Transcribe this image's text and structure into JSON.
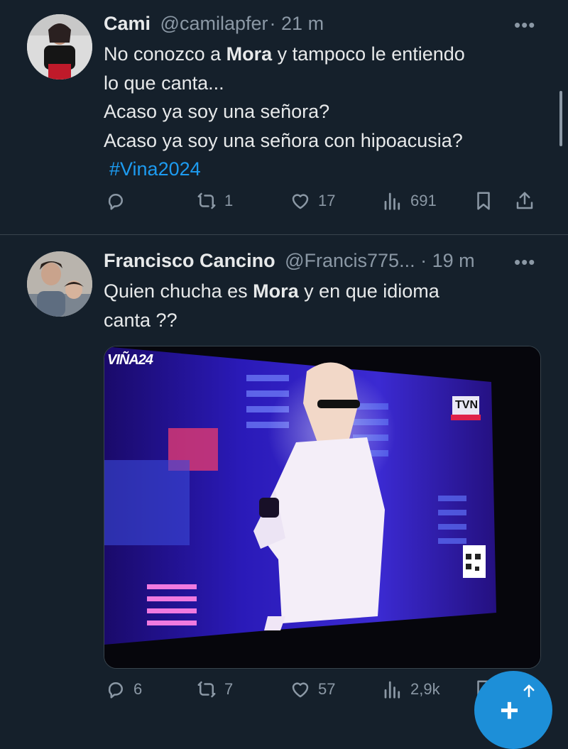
{
  "tweets": [
    {
      "author_name": "Cami",
      "handle": "@camilapfer",
      "separator": "·",
      "time": "21 m",
      "more": "•••",
      "lines": [
        {
          "pre": "No conozco a ",
          "bold": "Mora",
          "post": " y tampoco le entiendo"
        },
        {
          "text": "lo que canta..."
        },
        {
          "text": "Acaso ya soy una señora?"
        },
        {
          "text": "Acaso ya soy una señora con hipoacusia?"
        }
      ],
      "hashtag": "#Vina2024",
      "actions": {
        "reply": "",
        "retweet": "1",
        "like": "17",
        "views": "691"
      },
      "icons": [
        "reply-icon",
        "retweet-icon",
        "like-icon",
        "views-icon",
        "bookmark-icon",
        "share-icon"
      ]
    },
    {
      "author_name": "Francisco Cancino",
      "handle": "@Francis775...",
      "separator": "·",
      "time": "19 m",
      "more": "•••",
      "lines": [
        {
          "pre": "Quien chucha es ",
          "bold": "Mora",
          "post": " y en que idioma"
        },
        {
          "text": "canta ??"
        }
      ],
      "media": {
        "overlay_left": "VIÑA24",
        "overlay_right": "TVN"
      },
      "actions": {
        "reply": "6",
        "retweet": "7",
        "like": "57",
        "views": "2,9k"
      },
      "icons": [
        "reply-icon",
        "retweet-icon",
        "like-icon",
        "views-icon",
        "bookmark-icon",
        "share-icon"
      ]
    }
  ],
  "fab": {
    "label": "+",
    "icon": "compose-icon"
  },
  "colors": {
    "background": "#15202b",
    "text": "#e7e9ea",
    "muted": "#8b98a5",
    "accent": "#1d9bf0",
    "divider": "#38444d"
  }
}
